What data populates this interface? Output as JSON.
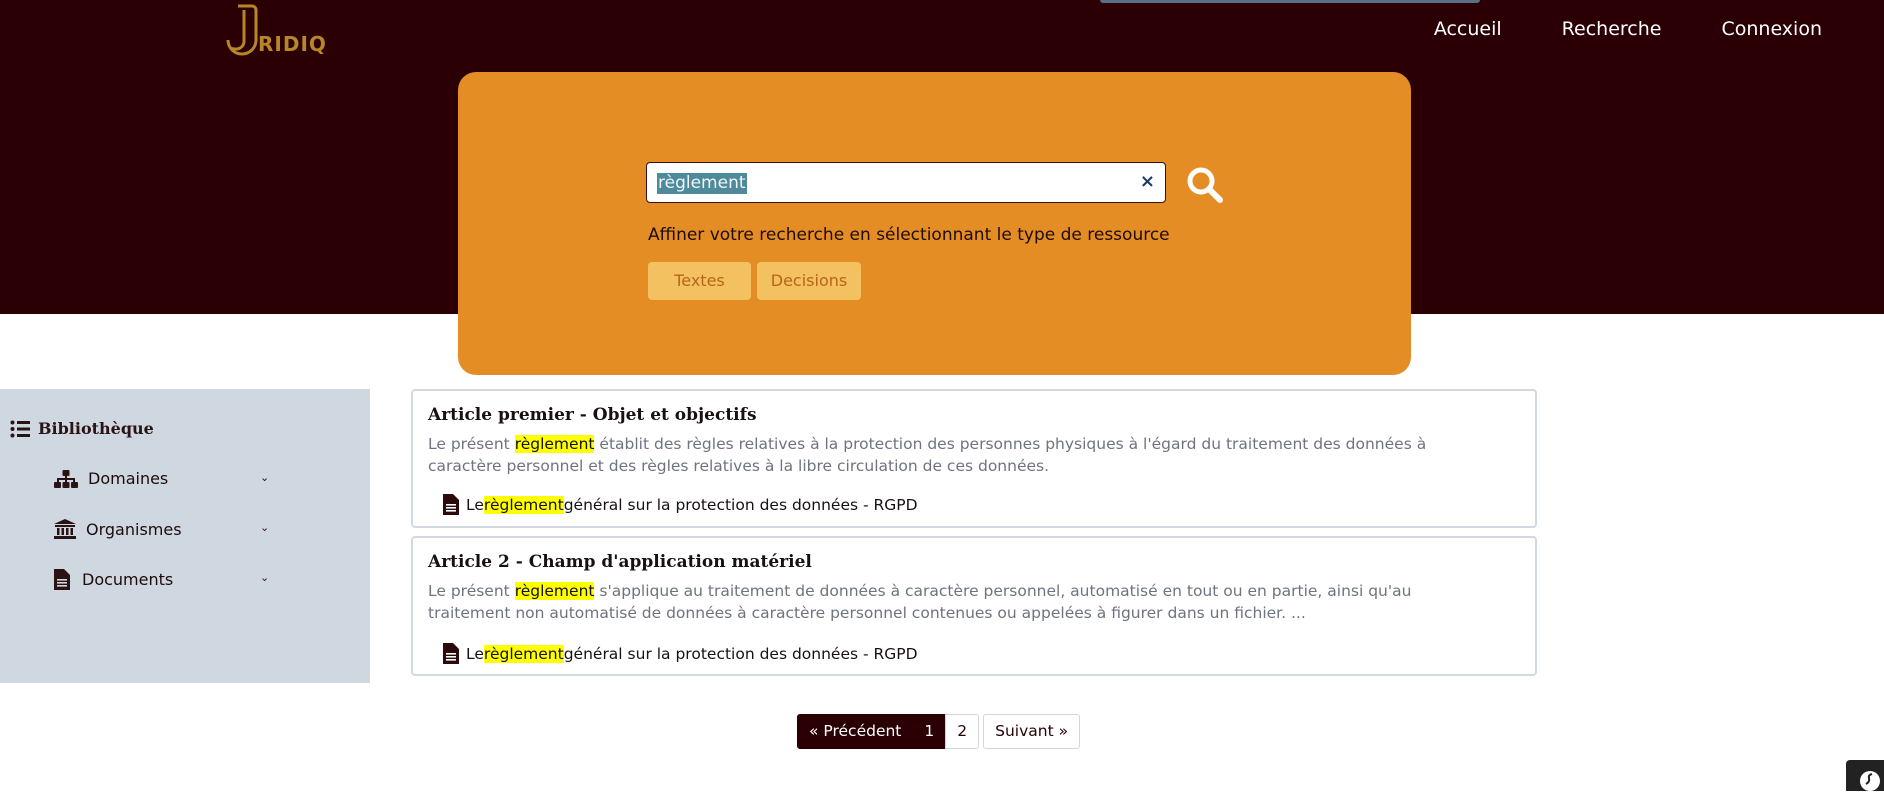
{
  "header": {
    "logo_text": "RIDIQ",
    "nav": [
      "Accueil",
      "Recherche",
      "Connexion"
    ]
  },
  "search": {
    "value": "règlement",
    "clear_label": "×",
    "refine_text": "Affiner votre recherche en sélectionnant le type de ressource",
    "chips": [
      "Textes",
      "Decisions"
    ]
  },
  "sidebar": {
    "title": "Bibliothèque",
    "items": [
      {
        "label": "Domaines",
        "icon": "sitemap-icon"
      },
      {
        "label": "Organismes",
        "icon": "institution-icon"
      },
      {
        "label": "Documents",
        "icon": "file-icon"
      }
    ]
  },
  "results": [
    {
      "title": "Article premier - Objet et objectifs",
      "snippet_pre": "Le présent ",
      "highlight": "règlement",
      "snippet_post": " établit des règles relatives à la protection des personnes physiques à l'égard du traitement des données à caractère personnel et des règles relatives à la libre circulation de ces données.",
      "source_pre": "Le ",
      "source_highlight": "règlement",
      "source_post": " général sur la protection des données - RGPD"
    },
    {
      "title": "Article 2 - Champ d'application matériel",
      "snippet_pre": "Le présent ",
      "highlight": "règlement",
      "snippet_post": " s'applique au traitement de données à caractère personnel, automatisé en tout ou en partie, ainsi qu'au traitement non automatisé de données à caractère personnel contenues ou appelées à figurer dans un fichier. ...",
      "source_pre": "Le ",
      "source_highlight": "règlement",
      "source_post": " général sur la protection des données - RGPD"
    }
  ],
  "pagination": {
    "prev": "« Précédent",
    "pages": [
      "1",
      "2"
    ],
    "current": "1",
    "next": "Suivant »"
  },
  "colors": {
    "header_bg": "#2a0004",
    "accent": "#e58d25",
    "chip_bg": "#f3c15f",
    "highlight": "#ffff00"
  }
}
